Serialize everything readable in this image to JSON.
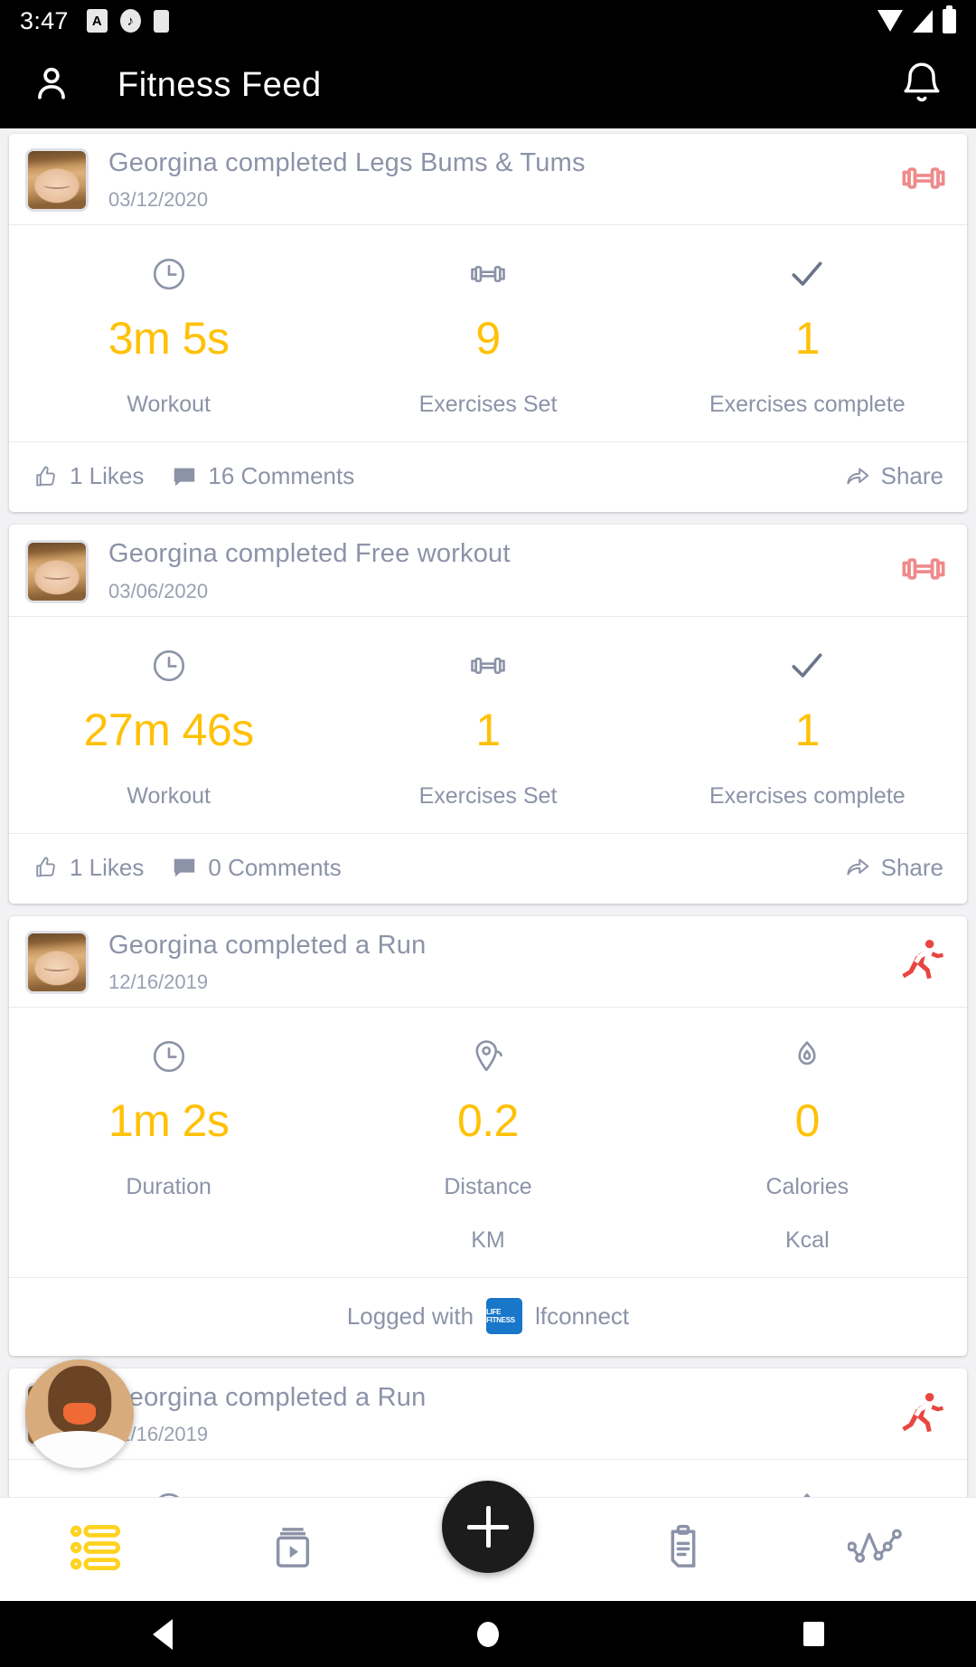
{
  "status_bar": {
    "time": "3:47",
    "left_icons": [
      "alert-icon",
      "media-icon",
      "battery-saver-icon"
    ],
    "right_icons": [
      "wifi-icon",
      "signal-icon",
      "battery-icon"
    ]
  },
  "app_bar": {
    "profile_icon": "person-icon",
    "title": "Fitness Feed",
    "notification_icon": "bell-icon"
  },
  "colors": {
    "accent_value": "#ffc107",
    "muted_text": "#8c93a8",
    "workout_icon": "#ef8a8a",
    "run_icon": "#e8463f",
    "lf_badge": "#1877c9"
  },
  "feed": {
    "posts": [
      {
        "type": "workout",
        "title": "Georgina completed Legs Bums & Tums",
        "date": "03/12/2020",
        "type_icon": "dumbbell-icon",
        "stats": [
          {
            "icon": "clock-icon",
            "value": "3m 5s",
            "label": "Workout",
            "unit": ""
          },
          {
            "icon": "dumbbell-icon",
            "value": "9",
            "label": "Exercises Set",
            "unit": ""
          },
          {
            "icon": "check-icon",
            "value": "1",
            "label": "Exercises complete",
            "unit": ""
          }
        ],
        "footer": {
          "likes": "1 Likes",
          "comments": "16 Comments",
          "share": "Share"
        }
      },
      {
        "type": "workout",
        "title": "Georgina completed Free workout",
        "date": "03/06/2020",
        "type_icon": "dumbbell-icon",
        "stats": [
          {
            "icon": "clock-icon",
            "value": "27m 46s",
            "label": "Workout",
            "unit": ""
          },
          {
            "icon": "dumbbell-icon",
            "value": "1",
            "label": "Exercises Set",
            "unit": ""
          },
          {
            "icon": "check-icon",
            "value": "1",
            "label": "Exercises complete",
            "unit": ""
          }
        ],
        "footer": {
          "likes": "1 Likes",
          "comments": "0 Comments",
          "share": "Share"
        }
      },
      {
        "type": "run",
        "title": "Georgina completed a Run",
        "date": "12/16/2019",
        "type_icon": "runner-icon",
        "stats": [
          {
            "icon": "clock-icon",
            "value": "1m 2s",
            "label": "Duration",
            "unit": ""
          },
          {
            "icon": "location-icon",
            "value": "0.2",
            "label": "Distance",
            "unit": "KM"
          },
          {
            "icon": "flame-icon",
            "value": "0",
            "label": "Calories",
            "unit": "Kcal"
          }
        ],
        "logged_with": {
          "prefix": "Logged with",
          "badge_label": "LIFE FITNESS",
          "app": "lfconnect"
        }
      },
      {
        "type": "run",
        "title": "Georgina completed a Run",
        "date": "12/16/2019",
        "type_icon": "runner-icon"
      }
    ]
  },
  "floating_avatar": {
    "name": "floating-user-avatar"
  },
  "bottom_nav": {
    "items": [
      {
        "icon": "feed-list-icon",
        "active": true
      },
      {
        "icon": "video-icon",
        "active": false
      },
      {
        "icon": "clipboard-icon",
        "active": false
      },
      {
        "icon": "activity-icon",
        "active": false
      }
    ],
    "fab_icon": "plus-icon"
  },
  "android_nav": {
    "back": "back-icon",
    "home": "home-icon",
    "recents": "recents-icon"
  }
}
